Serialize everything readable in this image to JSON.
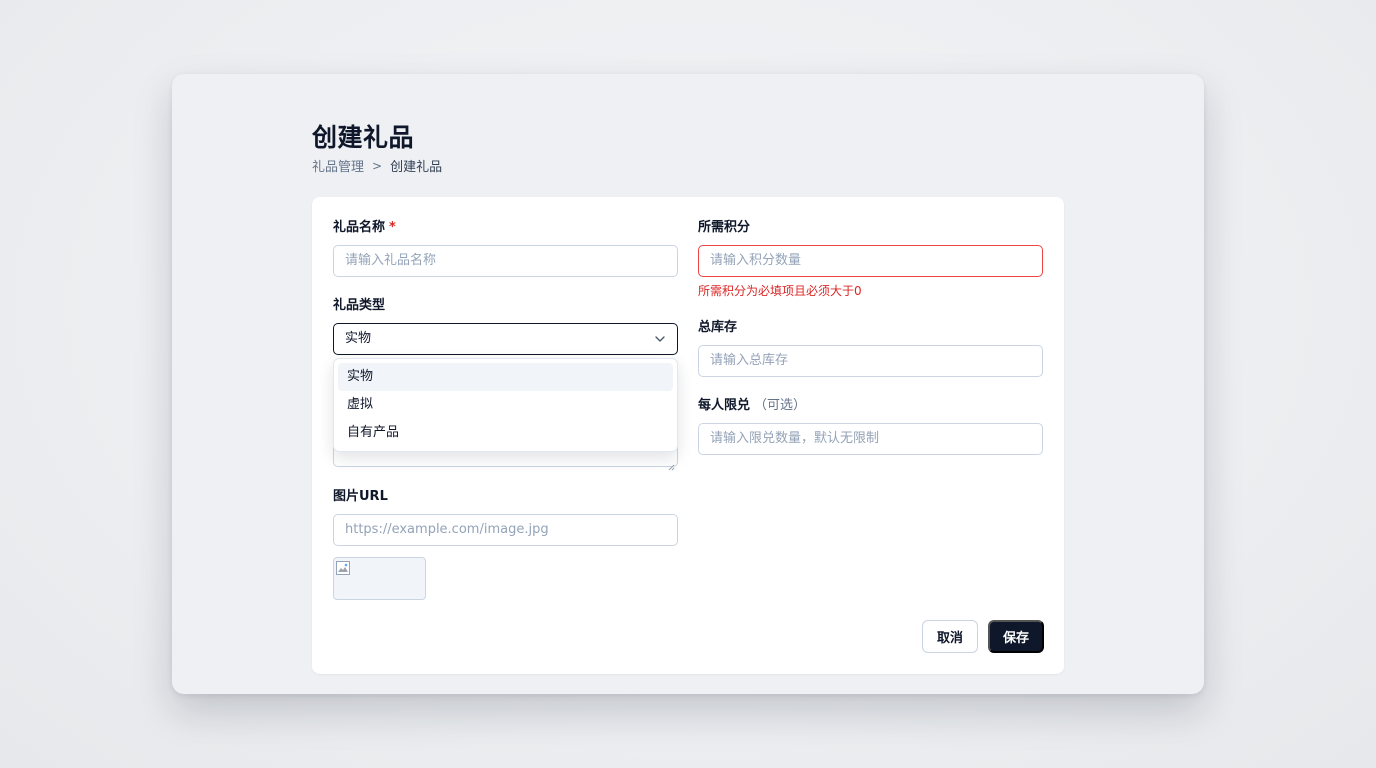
{
  "page": {
    "title": "创建礼品",
    "breadcrumb": {
      "parent": "礼品管理",
      "separator": ">",
      "current": "创建礼品"
    }
  },
  "form": {
    "name": {
      "label": "礼品名称",
      "required_mark": "*",
      "placeholder": "请输入礼品名称"
    },
    "points": {
      "label": "所需积分",
      "placeholder": "请输入积分数量",
      "error": "所需积分为必填项且必须大于0"
    },
    "type": {
      "label": "礼品类型",
      "selected": "实物",
      "options": [
        "实物",
        "虚拟",
        "自有产品"
      ],
      "highlighted_option": "实物"
    },
    "stock": {
      "label": "总库存",
      "placeholder": "请输入总库存"
    },
    "limit": {
      "label": "每人限兑",
      "optional_note": "（可选）",
      "placeholder": "请输入限兑数量，默认无限制"
    },
    "image_url": {
      "label": "图片URL",
      "placeholder": "https://example.com/image.jpg"
    }
  },
  "actions": {
    "cancel_label": "取消",
    "save_label": "保存"
  },
  "icons": {
    "select_arrow": "chevron-down-icon",
    "image_placeholder": "broken-image-icon",
    "resize": "resize-handle-icon"
  },
  "colors": {
    "primary": "#0f172a",
    "error": "#dc2626",
    "border": "#cbd5e1"
  }
}
